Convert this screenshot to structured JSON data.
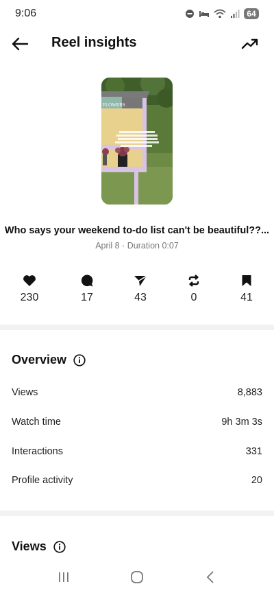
{
  "status_bar": {
    "time": "9:06",
    "battery": "64",
    "icons": [
      "do-not-disturb-icon",
      "sleep-icon",
      "wifi-icon",
      "signal-icon"
    ]
  },
  "header": {
    "title": "Reel insights",
    "back_icon": "arrow-left-icon",
    "trend_icon": "trending-up-icon"
  },
  "reel": {
    "caption": "Who says your weekend to-do list can't be beautiful??...",
    "meta": "April 8 · Duration 0:07",
    "thumbnail_sign": "FLOWERS",
    "thumbnail_text": "Girls be like \"I need to relax\" and it's literally just arranging flowers, a sweet treat, and a sunny day and a good playlist"
  },
  "stats": [
    {
      "icon": "heart-icon",
      "value": "230"
    },
    {
      "icon": "comment-icon",
      "value": "17"
    },
    {
      "icon": "share-icon",
      "value": "43"
    },
    {
      "icon": "repost-icon",
      "value": "0"
    },
    {
      "icon": "bookmark-icon",
      "value": "41"
    }
  ],
  "overview": {
    "title": "Overview",
    "rows": [
      {
        "label": "Views",
        "value": "8,883"
      },
      {
        "label": "Watch time",
        "value": "9h 3m 3s"
      },
      {
        "label": "Interactions",
        "value": "331"
      },
      {
        "label": "Profile activity",
        "value": "20"
      }
    ]
  },
  "views_section": {
    "title": "Views"
  },
  "colors": {
    "text": "#111111",
    "muted": "#777777",
    "divider": "#f2f2f2"
  }
}
